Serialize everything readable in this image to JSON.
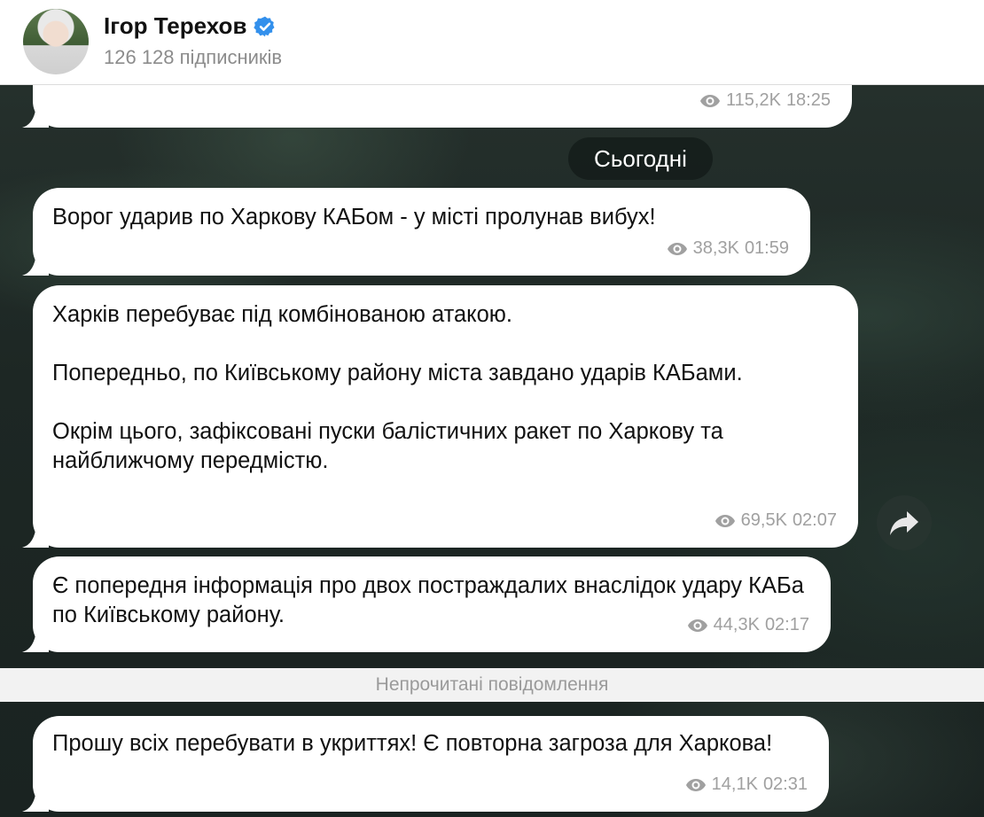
{
  "header": {
    "channel_name": "Ігор Терехов",
    "subscribers": "126 128 підписників"
  },
  "date_divider": "Сьогодні",
  "unread_divider": "Непрочитані повідомлення",
  "messages": [
    {
      "text": "",
      "views": "115,2K",
      "time": "18:25"
    },
    {
      "text": "Ворог ударив по Харкову КАБом - у місті пролунав вибух!",
      "views": "38,3K",
      "time": "01:59"
    },
    {
      "text": "Харків перебуває під комбінованою атакою.\n\nПопередньо, по Київському району міста завдано ударів КАБами.\n\nОкрім цього, зафіксовані пуски балістичних ракет по Харкову та найближчому передмістю.",
      "views": "69,5K",
      "time": "02:07"
    },
    {
      "text": "Є попередня інформація про двох постраждалих внаслідок удару КАБа по Київському району.",
      "views": "44,3K",
      "time": "02:17"
    },
    {
      "text": "Прошу всіх перебувати в укриттях! Є повторна загроза для Харкова!",
      "views": "14,1K",
      "time": "02:31"
    }
  ],
  "icons": {
    "verified": "verified-badge-icon",
    "views": "eye-icon",
    "share": "share-arrow-icon"
  },
  "colors": {
    "verified": "#3390ec",
    "meta_text": "#a0a0a0"
  }
}
